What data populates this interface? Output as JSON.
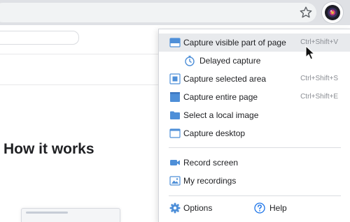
{
  "colors": {
    "accent_blue": "#4e8fd8",
    "toolbar_bg": "#dfe1e5",
    "highlight_bg": "#e8eaed",
    "help_blue": "#1a73e8"
  },
  "site": {
    "heading": "How it works"
  },
  "menu": {
    "items": [
      {
        "label": "Capture visible part of page",
        "shortcut": "Ctrl+Shift+V",
        "icon": "capture-visible-icon",
        "highlighted": true
      },
      {
        "label": "Delayed capture",
        "shortcut": "",
        "icon": "timer-icon"
      },
      {
        "label": "Capture selected area",
        "shortcut": "Ctrl+Shift+S",
        "icon": "selected-area-icon"
      },
      {
        "label": "Capture entire page",
        "shortcut": "Ctrl+Shift+E",
        "icon": "entire-page-icon"
      },
      {
        "label": "Select a local image",
        "shortcut": "",
        "icon": "folder-icon"
      },
      {
        "label": "Capture desktop",
        "shortcut": "",
        "icon": "desktop-icon"
      },
      {
        "label": "Record screen",
        "shortcut": "",
        "icon": "video-camera-icon"
      },
      {
        "label": "My recordings",
        "shortcut": "",
        "icon": "image-icon"
      }
    ],
    "options_label": "Options",
    "help_label": "Help"
  }
}
